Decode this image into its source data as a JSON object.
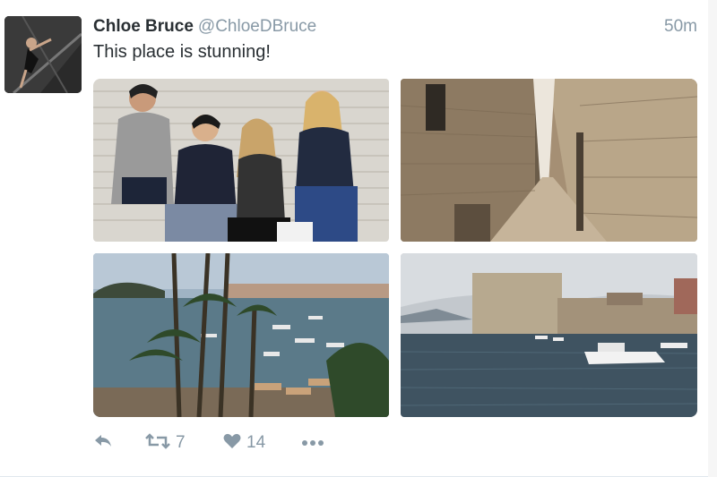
{
  "tweet": {
    "author_name": "Chloe Bruce",
    "author_handle": "@ChloeDBruce",
    "time": "50m",
    "text": "This place is stunning!",
    "retweet_count": "7",
    "like_count": "14"
  },
  "icons": {
    "reply": "reply-icon",
    "retweet": "retweet-icon",
    "like": "heart-icon",
    "more": "more-dots-icon"
  },
  "colors": {
    "text": "#292f33",
    "muted": "#8899a6",
    "divider": "#e1e8ed"
  }
}
